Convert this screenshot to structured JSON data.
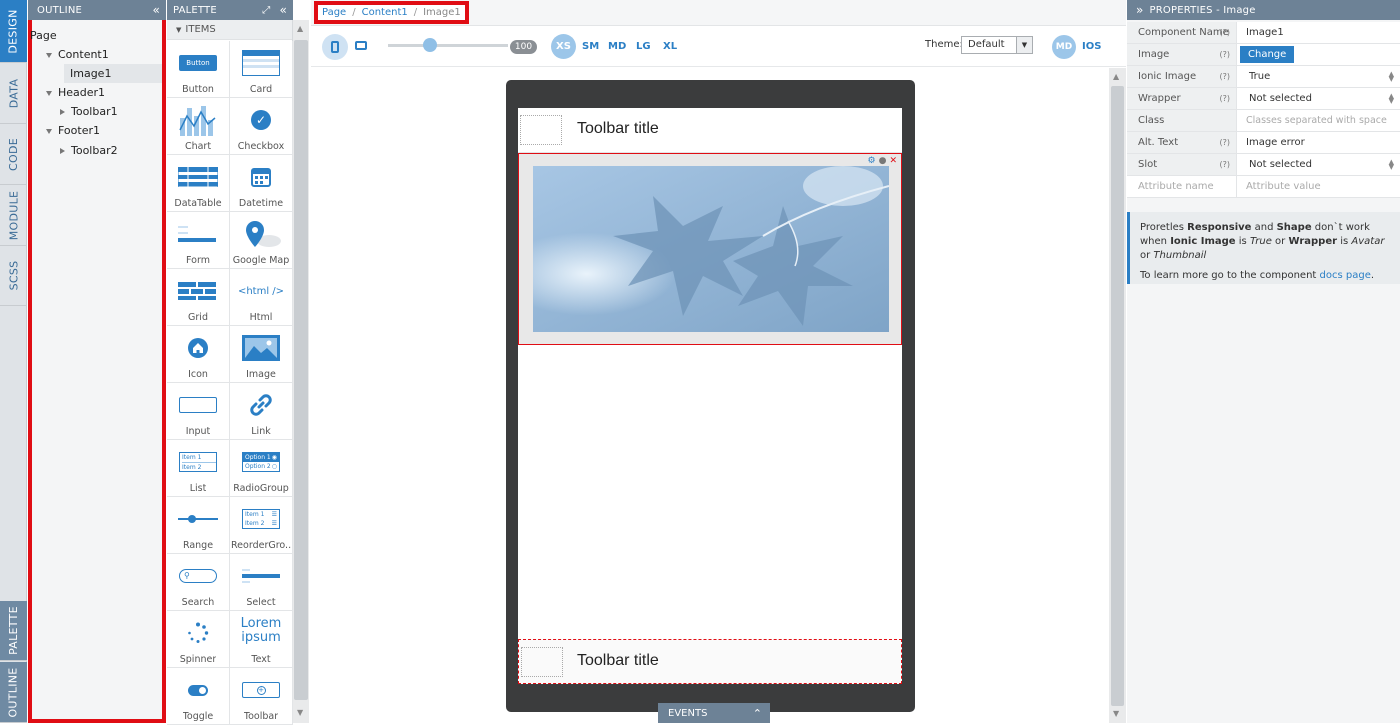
{
  "left_tabs": [
    "DESIGN",
    "DATA",
    "CODE",
    "MODULE",
    "SCSS",
    "PALETTE",
    "OUTLINE"
  ],
  "outline": {
    "title": "OUTLINE",
    "collapse_icon": "double-chevron-left-icon",
    "nodes": [
      "Page",
      "Content1",
      "Image1",
      "Header1",
      "Toolbar1",
      "Footer1",
      "Toolbar2"
    ]
  },
  "palette": {
    "title": "PALETTE",
    "section": "ITEMS",
    "items": [
      "Button",
      "Card",
      "Chart",
      "Checkbox",
      "DataTable",
      "Datetime",
      "Form",
      "Google Map",
      "Grid",
      "Html",
      "Icon",
      "Image",
      "Input",
      "Link",
      "List",
      "RadioGroup",
      "Range",
      "ReorderGro...",
      "Search",
      "Select",
      "Spinner",
      "Text",
      "Toggle",
      "Toolbar"
    ],
    "button_preview": "Button",
    "html_preview": "<html />",
    "text_preview_1": "Lorem",
    "text_preview_2": "ipsum",
    "list_preview": [
      "Item 1",
      "Item 2"
    ],
    "radio_preview": [
      "Option 1",
      "Option 2"
    ],
    "reorder_preview": [
      "Item 1",
      "Item 2"
    ]
  },
  "breadcrumb": {
    "items": [
      "Page",
      "Content1",
      "Image1"
    ],
    "separator": "/"
  },
  "toolbar": {
    "zoom_value": "100",
    "zoom_fraction": 0.35,
    "breakpoints": [
      "XS",
      "SM",
      "MD",
      "LG",
      "XL"
    ],
    "theme_label": "Theme:",
    "theme_value": "Default",
    "platform_badge": "MD",
    "platform_ios": "IOS"
  },
  "device": {
    "header_title": "Toolbar title",
    "footer_title": "Toolbar title"
  },
  "events": {
    "label": "EVENTS"
  },
  "properties": {
    "title": "PROPERTIES - Image",
    "help": "(?)",
    "rows": [
      {
        "key": "Component Name",
        "value": "Image1"
      },
      {
        "key": "Image",
        "value": "Change"
      },
      {
        "key": "Ionic Image",
        "value": "True"
      },
      {
        "key": "Wrapper",
        "value": "Not selected"
      },
      {
        "key": "Class",
        "value": "Classes separated with space"
      },
      {
        "key": "Alt. Text",
        "value": "Image error"
      },
      {
        "key": "Slot",
        "value": "Not selected"
      }
    ],
    "attr_name_placeholder": "Attribute name",
    "attr_value_placeholder": "Attribute value",
    "info": {
      "t1": "Proretles ",
      "b1": "Responsive",
      "t2": " and ",
      "b2": "Shape",
      "t3": " don`t work when ",
      "b3": "Ionic Image",
      "t4": " is ",
      "i1": "True",
      "t5": " or ",
      "b4": "Wrapper",
      "t6": " is ",
      "i2": "Avatar",
      "t7": " or ",
      "i3": "Thumbnail",
      "t8": "To learn more go to the component ",
      "link": "docs page",
      "t9": "."
    }
  },
  "colors": {
    "accent": "#2b7fc5",
    "highlight": "#e00d14",
    "panel_header": "#6d8296"
  }
}
